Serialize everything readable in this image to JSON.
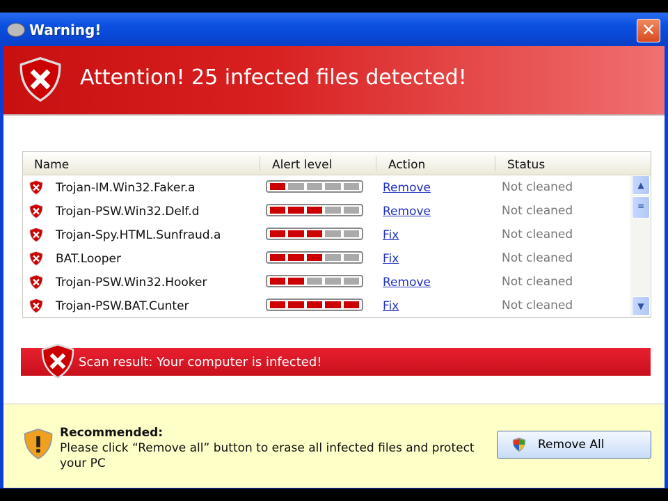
{
  "window": {
    "title": "Warning!",
    "close": "✕"
  },
  "header": {
    "title": "Attention! 25 infected files detected!"
  },
  "table": {
    "columns": [
      "Name",
      "Alert level",
      "Action",
      "Status"
    ],
    "rows": [
      {
        "name": "Trojan-IM.Win32.Faker.a",
        "level": 1,
        "action": "Remove",
        "status": "Not cleaned"
      },
      {
        "name": "Trojan-PSW.Win32.Delf.d",
        "level": 3,
        "action": "Remove",
        "status": "Not cleaned"
      },
      {
        "name": "Trojan-Spy.HTML.Sunfraud.a",
        "level": 3,
        "action": "Fix",
        "status": "Not cleaned"
      },
      {
        "name": "BAT.Looper",
        "level": 3,
        "action": "Fix",
        "status": "Not cleaned"
      },
      {
        "name": "Trojan-PSW.Win32.Hooker",
        "level": 2,
        "action": "Remove",
        "status": "Not cleaned"
      },
      {
        "name": "Trojan-PSW.BAT.Cunter",
        "level": 5,
        "action": "Fix",
        "status": "Not cleaned"
      }
    ],
    "level_max": 5
  },
  "scan": {
    "text": "Scan result: Your computer is infected!"
  },
  "recommend": {
    "title": "Recommended:",
    "text": "Please click “Remove all” button to erase all infected files and protect your PC",
    "button": "Remove All"
  }
}
